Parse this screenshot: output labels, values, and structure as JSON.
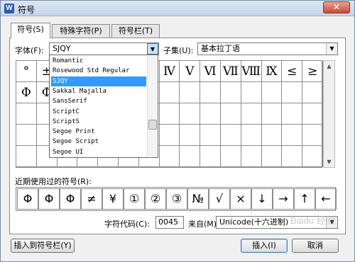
{
  "window": {
    "title": "符号",
    "app_icon": "W",
    "close": "✕"
  },
  "tabs": [
    "符号(S)",
    "特殊字符(P)",
    "符号栏(T)"
  ],
  "font_label": "字体(F):",
  "font_value": "SJQY",
  "subset_label": "子集(U):",
  "subset_value": "基本拉丁语",
  "symbols": [
    [
      "°",
      "±",
      "",
      "",
      "",
      "",
      "",
      "Ⅳ",
      "Ⅴ",
      "Ⅵ",
      "Ⅶ",
      "Ⅷ",
      "Ⅸ",
      "≤",
      "≥"
    ],
    [
      "Φ",
      "Φ",
      "",
      "",
      "",
      "",
      "",
      "",
      "",
      "",
      "",
      "",
      "",
      "",
      ""
    ],
    [
      "",
      "",
      "",
      "",
      "",
      "",
      "",
      "",
      "",
      "",
      "",
      "",
      "",
      "",
      ""
    ],
    [
      "",
      "",
      "",
      "",
      "",
      "",
      "",
      "",
      "",
      "",
      "",
      "",
      "",
      "",
      ""
    ],
    [
      "",
      "",
      "",
      "",
      "",
      "",
      "",
      "",
      "",
      "",
      "",
      "",
      "",
      "",
      ""
    ]
  ],
  "font_list": [
    "Romantic",
    "Rosewood Std Regular",
    "SJQY",
    "Sakkal Majalla",
    "SansSerif",
    "ScriptC",
    "ScriptS",
    "Segoe Print",
    "Segoe Script",
    "Segoe UI"
  ],
  "font_list_selected": 2,
  "recent_label": "近期使用过的符号(R):",
  "recent_symbols": [
    "Φ",
    "Φ",
    "Φ",
    "≠",
    "¥",
    "①",
    "②",
    "③",
    "№",
    "√",
    "×",
    "↓",
    "→",
    "↑",
    "←"
  ],
  "char_code_label": "字符代码(C):",
  "char_code_value": "0045",
  "from_label": "来自(M)",
  "from_value": "Unicode(十六进制)",
  "buttons": {
    "insert_to_bar": "插入到符号栏(Y)",
    "insert": "插入(I)",
    "cancel": "取消"
  },
  "watermark": "Baidu 经验"
}
